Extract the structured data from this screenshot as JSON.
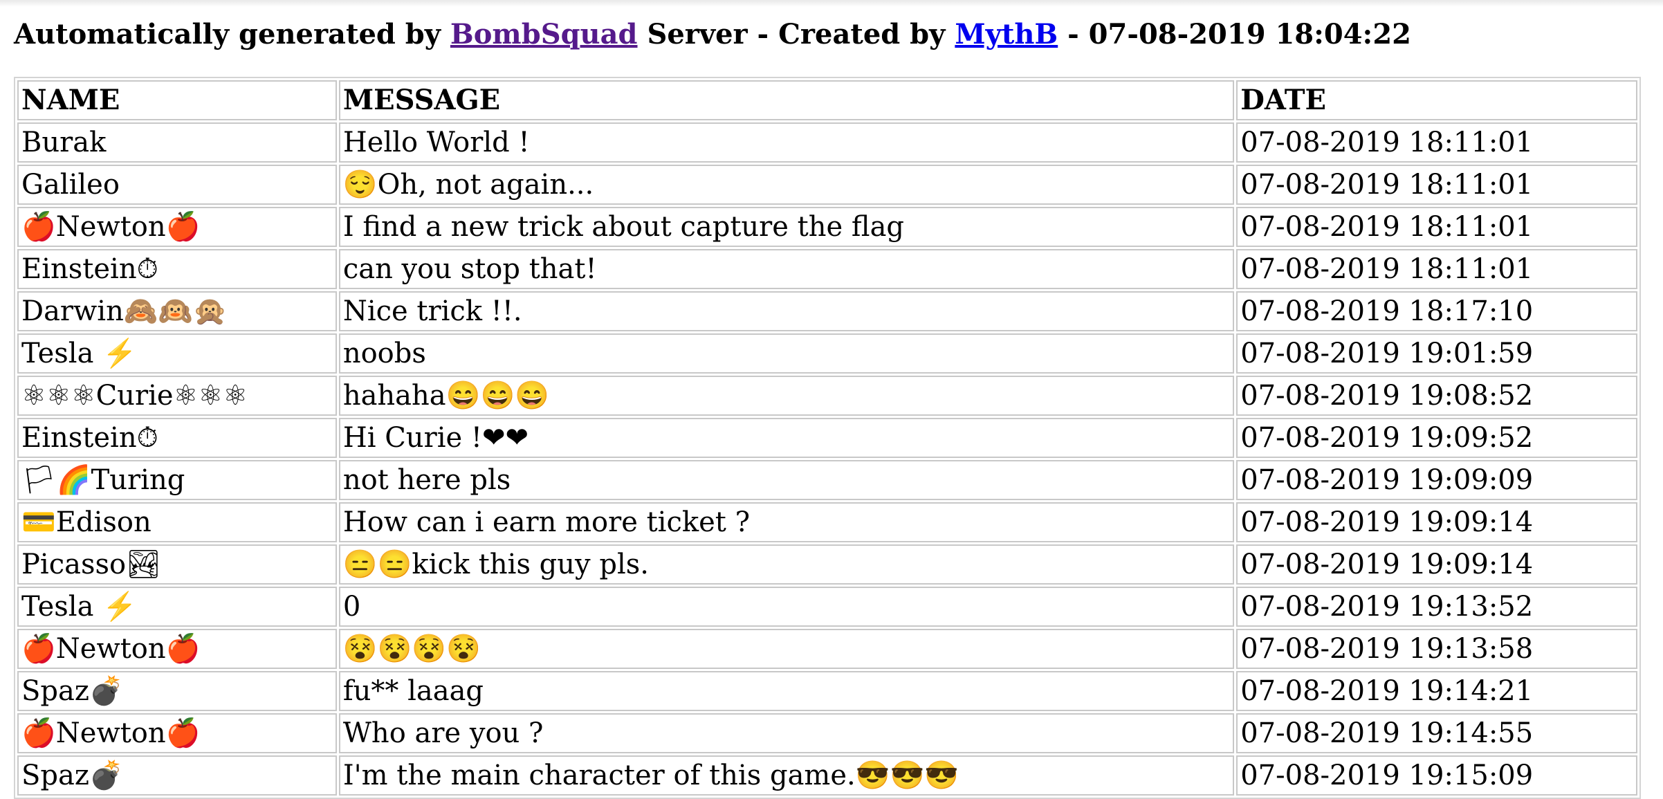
{
  "header": {
    "prefix": "Automatically generated by ",
    "app_link": "BombSquad",
    "middle": " Server - Created by ",
    "author_link": "MythB",
    "suffix": " - 07-08-2019 18:04:22"
  },
  "table": {
    "headers": [
      "NAME",
      "MESSAGE",
      "DATE"
    ],
    "rows": [
      {
        "name": "Burak",
        "message": "Hello World !",
        "date": "07-08-2019 18:11:01"
      },
      {
        "name": "Galileo",
        "message": "😌Oh, not again...",
        "date": "07-08-2019 18:11:01"
      },
      {
        "name": "🍎Newton🍎",
        "message": "I find a new trick about capture the flag",
        "date": "07-08-2019 18:11:01"
      },
      {
        "name": "Einstein⏱",
        "message": "can you stop that!",
        "date": "07-08-2019 18:11:01"
      },
      {
        "name": "Darwin🙈🙉🙊",
        "message": "Nice trick !!.",
        "date": "07-08-2019 18:17:10"
      },
      {
        "name": "Tesla ⚡",
        "message": "noobs",
        "date": "07-08-2019 19:01:59"
      },
      {
        "name": "⚛⚛⚛Curie⚛⚛⚛",
        "message": "hahaha😄😄😄",
        "date": "07-08-2019 19:08:52"
      },
      {
        "name": "Einstein⏱",
        "message": "Hi Curie !❤❤",
        "date": "07-08-2019 19:09:52"
      },
      {
        "name": "🏳🌈Turing",
        "message": "not here pls",
        "date": "07-08-2019 19:09:09"
      },
      {
        "name": "💳Edison",
        "message": "How can i earn more ticket ?",
        "date": "07-08-2019 19:09:14"
      },
      {
        "name": "Picasso🏞",
        "message": "😑😑kick this guy pls.",
        "date": "07-08-2019 19:09:14"
      },
      {
        "name": "Tesla ⚡",
        "message": "0",
        "date": "07-08-2019 19:13:52"
      },
      {
        "name": "🍎Newton🍎",
        "message": "😵😵😵😵",
        "date": "07-08-2019 19:13:58"
      },
      {
        "name": "Spaz💣",
        "message": "fu** laaag",
        "date": "07-08-2019 19:14:21"
      },
      {
        "name": "🍎Newton🍎",
        "message": "Who are you ?",
        "date": "07-08-2019 19:14:55"
      },
      {
        "name": "Spaz💣",
        "message": "I'm the main character of this game.😎😎😎",
        "date": "07-08-2019 19:15:09"
      }
    ]
  },
  "colors": {
    "visited_link": "#551a8b",
    "link": "#0000ee",
    "cell_border": "#c8c8c8"
  }
}
